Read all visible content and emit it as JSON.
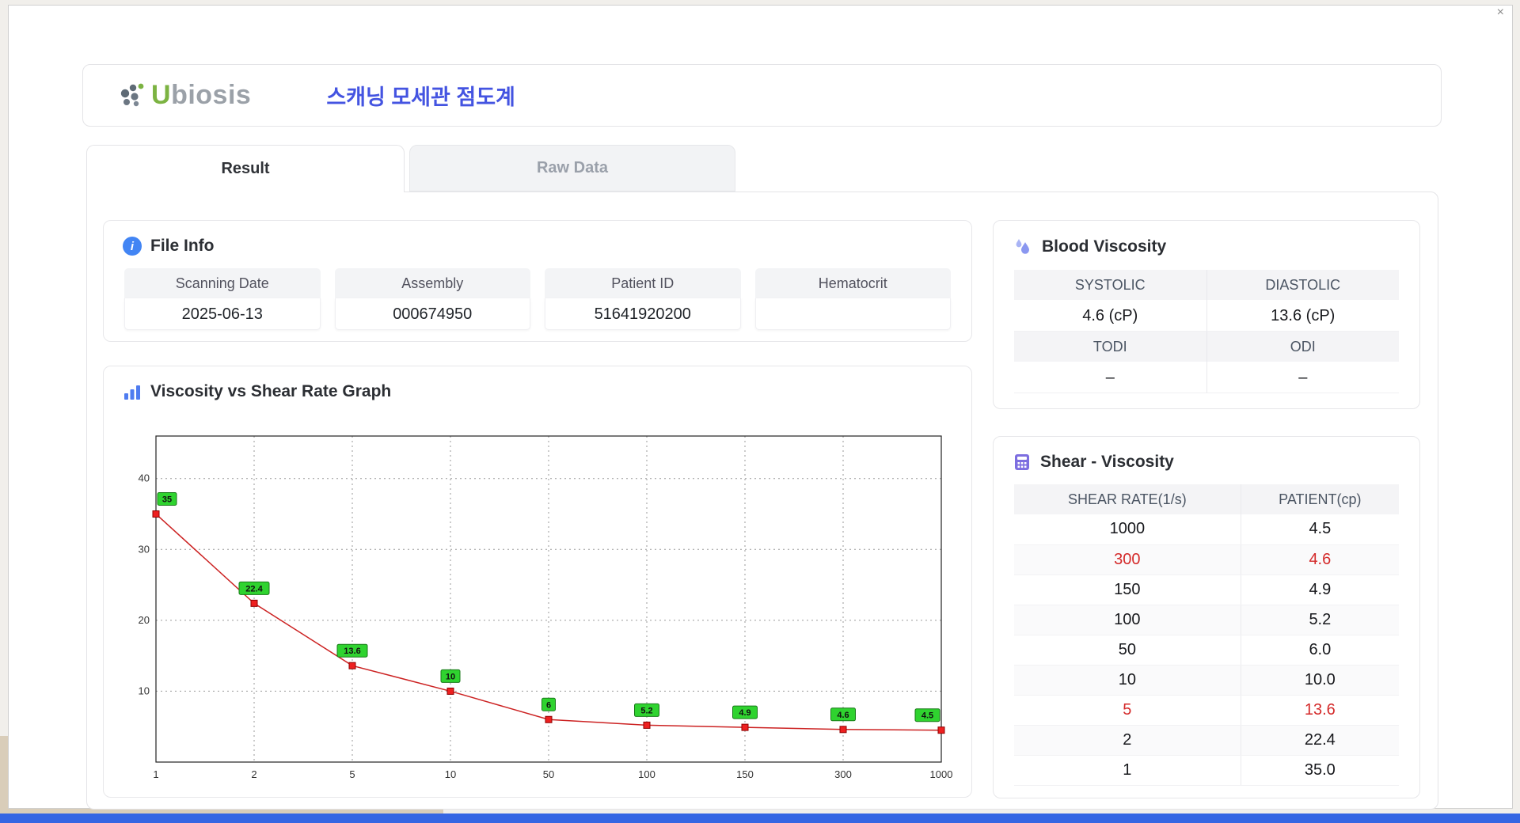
{
  "window": {
    "close": "×"
  },
  "header": {
    "logo_first": "U",
    "logo_rest": "biosis",
    "title": "스캐닝 모세관 점도계"
  },
  "tabs": {
    "result": "Result",
    "raw": "Raw Data"
  },
  "file_info": {
    "title": "File Info",
    "fields": [
      {
        "label": "Scanning Date",
        "value": "2025-06-13"
      },
      {
        "label": "Assembly",
        "value": "000674950"
      },
      {
        "label": "Patient ID",
        "value": "51641920200"
      },
      {
        "label": "Hematocrit",
        "value": ""
      }
    ]
  },
  "graph": {
    "title": "Viscosity vs Shear Rate Graph"
  },
  "blood_viscosity": {
    "title": "Blood Viscosity",
    "row1_labels": [
      "SYSTOLIC",
      "DIASTOLIC"
    ],
    "row1_values": [
      "4.6 (cP)",
      "13.6 (cP)"
    ],
    "row2_labels": [
      "TODI",
      "ODI"
    ],
    "row2_values": [
      "–",
      "–"
    ]
  },
  "shear_viscosity": {
    "title": "Shear - Viscosity",
    "columns": [
      "SHEAR RATE(1/s)",
      "PATIENT(cp)"
    ],
    "rows": [
      {
        "shear": "1000",
        "patient": "4.5",
        "highlight": false
      },
      {
        "shear": "300",
        "patient": "4.6",
        "highlight": true
      },
      {
        "shear": "150",
        "patient": "4.9",
        "highlight": false
      },
      {
        "shear": "100",
        "patient": "5.2",
        "highlight": false
      },
      {
        "shear": "50",
        "patient": "6.0",
        "highlight": false
      },
      {
        "shear": "10",
        "patient": "10.0",
        "highlight": false
      },
      {
        "shear": "5",
        "patient": "13.6",
        "highlight": true
      },
      {
        "shear": "2",
        "patient": "22.4",
        "highlight": false
      },
      {
        "shear": "1",
        "patient": "35.0",
        "highlight": false
      }
    ]
  },
  "chart_data": {
    "type": "line",
    "title": "Viscosity vs Shear Rate Graph",
    "xlabel": "",
    "ylabel": "",
    "x_axis_type": "category",
    "x": [
      "1",
      "2",
      "5",
      "10",
      "50",
      "100",
      "150",
      "300",
      "1000"
    ],
    "values": [
      35,
      22.4,
      13.6,
      10,
      6,
      5.2,
      4.9,
      4.6,
      4.5
    ],
    "point_labels": [
      "35",
      "22.4",
      "13.6",
      "10",
      "6",
      "5.2",
      "4.9",
      "4.6",
      "4.5"
    ],
    "yticks": [
      10,
      20,
      30,
      40
    ],
    "ylim": [
      0,
      46
    ],
    "grid": true,
    "legend": false,
    "line_color": "#cc2222",
    "marker_color": "#ee2020",
    "marker_stroke": "#8f0000",
    "label_bg": "#2fd32f",
    "label_border": "#187a18"
  },
  "colors": {
    "accent_blue": "#4454e1",
    "icon_blue": "#4285f4",
    "icon_purple": "#7d6ee0",
    "icon_droplet": "#8a97f0",
    "red_value": "#d42a2a",
    "logo_green": "#7cb342",
    "logo_gray": "#9ba1a8",
    "taskbar_blue": "#3566e3"
  }
}
